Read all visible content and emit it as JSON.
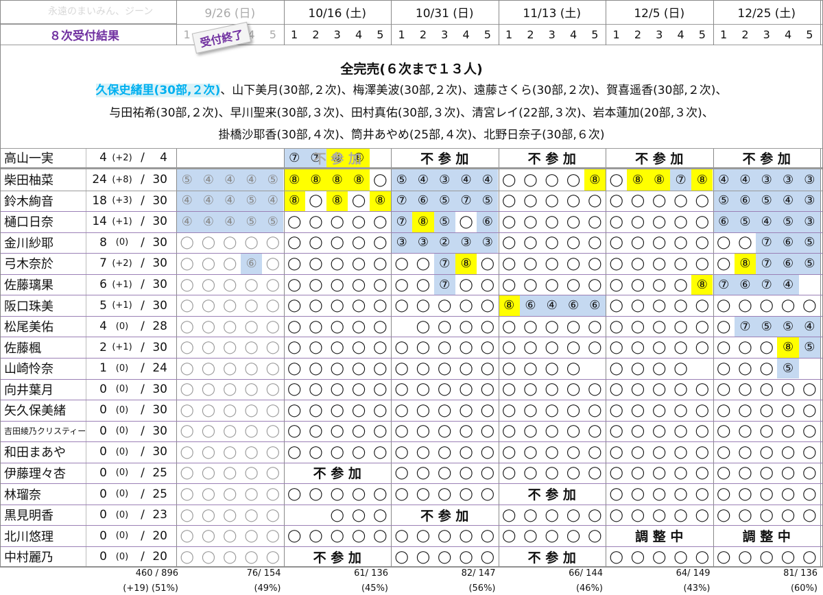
{
  "header": {
    "corner_watermark": "永遠のまいみん、ジーン",
    "round_label": "８次受付結果",
    "stamp": "受付終了",
    "dates": [
      "9/26 (日)",
      "10/16 (土)",
      "10/31 (日)",
      "11/13 (土)",
      "12/5 (日)",
      "12/25 (土)"
    ],
    "slots": [
      "1",
      "2",
      "3",
      "4",
      "5"
    ]
  },
  "banner": {
    "title": "全完売(６次まで１３人)",
    "line1_highlight": "久保史緒里(30部,２次)",
    "line1_rest": "、山下美月(30部,２次)、梅澤美波(30部,２次)、遠藤さくら(30部,２次)、賀喜遥香(30部,２次)、",
    "line2": "与田祐希(30部,２次)、早川聖来(30部,３次)、田村真佑(30部,３次)、清宮レイ(22部,３次)、岩本蓮加(20部,３次)、",
    "line3": "掛橋沙耶香(30部,４次)、筒井あやめ(25部,４次)、北野日奈子(30部,６次)"
  },
  "colors": {
    "blue": "#c5d9f1",
    "yellow": "#ffff00",
    "purple": "#7030a0",
    "banner_highlight": "#dbf2f7",
    "highlight_text": "#00b0f0"
  },
  "members": [
    {
      "name": "高山一実",
      "sold": "4",
      "delta": "(+2)",
      "total": "4",
      "cells": [
        "",
        "",
        "",
        "",
        "",
        "b⑦",
        "b⑦",
        "y⑧",
        "y⑧",
        "",
        "",
        "",
        "",
        "",
        "",
        "",
        "",
        "",
        "",
        "",
        "",
        "",
        "",
        "",
        "",
        "",
        "",
        "",
        "",
        ""
      ],
      "spans": [
        {
          "col": 1,
          "text": "不 参 加",
          "gray": true
        },
        {
          "col": 2,
          "text": "不 参 加"
        },
        {
          "col": 3,
          "text": "不 参 加"
        },
        {
          "col": 4,
          "text": "不 参 加"
        },
        {
          "col": 5,
          "text": "不 参 加"
        }
      ]
    },
    {
      "name": "柴田柚菜",
      "sold": "24",
      "delta": "(+8)",
      "total": "30",
      "cells": [
        "b⑤",
        "b④",
        "b④",
        "b④",
        "b⑤",
        "y⑧",
        "y⑧",
        "y⑧",
        "y⑧",
        "O",
        "b⑤",
        "b④",
        "b③",
        "b④",
        "b④",
        "O",
        "O",
        "O",
        "O",
        "y⑧",
        "O",
        "y⑧",
        "y⑧",
        "b⑦",
        "y⑧",
        "b④",
        "b④",
        "b③",
        "b③",
        "b③"
      ],
      "spans": []
    },
    {
      "name": "鈴木絢音",
      "sold": "18",
      "delta": "(+3)",
      "total": "30",
      "cells": [
        "b④",
        "b④",
        "b④",
        "b⑤",
        "b④",
        "y⑧",
        "O",
        "y⑧",
        "O",
        "y⑧",
        "b⑦",
        "b⑥",
        "b⑤",
        "b⑦",
        "b⑤",
        "O",
        "O",
        "O",
        "O",
        "O",
        "O",
        "O",
        "O",
        "O",
        "O",
        "b⑤",
        "b⑥",
        "b⑤",
        "b④",
        "b③"
      ],
      "spans": []
    },
    {
      "name": "樋口日奈",
      "sold": "14",
      "delta": "(+1)",
      "total": "30",
      "cells": [
        "b④",
        "b④",
        "b④",
        "b⑤",
        "b⑤",
        "O",
        "O",
        "O",
        "O",
        "O",
        "b⑦",
        "y⑧",
        "b⑤",
        "O",
        "b⑥",
        "O",
        "O",
        "O",
        "O",
        "O",
        "O",
        "O",
        "O",
        "O",
        "O",
        "b⑥",
        "b⑤",
        "b④",
        "b⑤",
        "b③"
      ],
      "spans": []
    },
    {
      "name": "金川紗耶",
      "sold": "8",
      "delta": "(0)",
      "total": "30",
      "cells": [
        "O",
        "O",
        "O",
        "O",
        "O",
        "O",
        "O",
        "O",
        "O",
        "O",
        "b③",
        "b③",
        "b②",
        "b③",
        "b③",
        "O",
        "O",
        "O",
        "O",
        "O",
        "O",
        "O",
        "O",
        "O",
        "O",
        "O",
        "O",
        "b⑦",
        "b⑥",
        "b⑤"
      ],
      "spans": []
    },
    {
      "name": "弓木奈於",
      "sold": "7",
      "delta": "(+2)",
      "total": "30",
      "cells": [
        "O",
        "O",
        "O",
        "b⑥",
        "O",
        "O",
        "O",
        "O",
        "O",
        "O",
        "O",
        "O",
        "b⑦",
        "y⑧",
        "O",
        "O",
        "O",
        "O",
        "O",
        "O",
        "O",
        "O",
        "O",
        "O",
        "O",
        "O",
        "y⑧",
        "b⑦",
        "b⑥",
        "b⑤"
      ],
      "spans": []
    },
    {
      "name": "佐藤璃果",
      "sold": "6",
      "delta": "(+1)",
      "total": "30",
      "cells": [
        "O",
        "O",
        "O",
        "O",
        "O",
        "O",
        "O",
        "O",
        "O",
        "O",
        "O",
        "O",
        "b⑦",
        "O",
        "O",
        "O",
        "O",
        "O",
        "O",
        "O",
        "O",
        "O",
        "O",
        "O",
        "y⑧",
        "b⑦",
        "b⑥",
        "b⑦",
        "b④",
        ""
      ],
      "spans": []
    },
    {
      "name": "阪口珠美",
      "sold": "5",
      "delta": "(+1)",
      "total": "30",
      "cells": [
        "O",
        "O",
        "O",
        "O",
        "O",
        "O",
        "O",
        "O",
        "O",
        "O",
        "O",
        "O",
        "O",
        "O",
        "O",
        "y⑧",
        "b⑥",
        "b④",
        "b⑥",
        "b⑥",
        "O",
        "O",
        "O",
        "O",
        "O",
        "O",
        "O",
        "O",
        "O",
        "O"
      ],
      "spans": []
    },
    {
      "name": "松尾美佑",
      "sold": "4",
      "delta": "(0)",
      "total": "28",
      "cells": [
        "O",
        "O",
        "O",
        "O",
        "O",
        "O",
        "O",
        "O",
        "O",
        "O",
        "",
        "O",
        "O",
        "O",
        "O",
        "O",
        "O",
        "O",
        "O",
        "O",
        "O",
        "O",
        "O",
        "O",
        "O",
        "O",
        "b⑦",
        "b⑤",
        "b⑤",
        "b④"
      ],
      "spans": []
    },
    {
      "name": "佐藤楓",
      "sold": "2",
      "delta": "(+1)",
      "total": "30",
      "cells": [
        "O",
        "O",
        "O",
        "O",
        "O",
        "O",
        "O",
        "O",
        "O",
        "O",
        "O",
        "O",
        "O",
        "O",
        "O",
        "O",
        "O",
        "O",
        "O",
        "O",
        "O",
        "O",
        "O",
        "O",
        "O",
        "O",
        "O",
        "O",
        "y⑧",
        "b⑤"
      ],
      "spans": []
    },
    {
      "name": "山崎怜奈",
      "sold": "1",
      "delta": "(0)",
      "total": "24",
      "cells": [
        "O",
        "O",
        "O",
        "O",
        "O",
        "O",
        "O",
        "O",
        "O",
        "O",
        "O",
        "O",
        "O",
        "O",
        "O",
        "O",
        "O",
        "O",
        "O",
        "",
        "O",
        "O",
        "O",
        "O",
        "",
        "O",
        "O",
        "O",
        "b⑤",
        ""
      ],
      "spans": []
    },
    {
      "name": "向井葉月",
      "sold": "0",
      "delta": "(0)",
      "total": "30",
      "cells": [
        "O",
        "O",
        "O",
        "O",
        "O",
        "O",
        "O",
        "O",
        "O",
        "O",
        "O",
        "O",
        "O",
        "O",
        "O",
        "O",
        "O",
        "O",
        "O",
        "O",
        "O",
        "O",
        "O",
        "O",
        "O",
        "O",
        "O",
        "O",
        "O",
        "O"
      ],
      "spans": []
    },
    {
      "name": "矢久保美緒",
      "sold": "0",
      "delta": "(0)",
      "total": "30",
      "cells": [
        "O",
        "O",
        "O",
        "O",
        "O",
        "O",
        "O",
        "O",
        "O",
        "O",
        "O",
        "O",
        "O",
        "O",
        "O",
        "O",
        "O",
        "O",
        "O",
        "O",
        "O",
        "O",
        "O",
        "O",
        "O",
        "O",
        "O",
        "O",
        "O",
        "O"
      ],
      "spans": []
    },
    {
      "name": "吉田綾乃クリスティー",
      "sold": "0",
      "delta": "(0)",
      "total": "30",
      "small": true,
      "cells": [
        "O",
        "O",
        "O",
        "O",
        "O",
        "O",
        "O",
        "O",
        "O",
        "O",
        "O",
        "O",
        "O",
        "O",
        "O",
        "O",
        "O",
        "O",
        "O",
        "O",
        "O",
        "O",
        "O",
        "O",
        "O",
        "O",
        "O",
        "O",
        "O",
        "O"
      ],
      "spans": []
    },
    {
      "name": "和田まあや",
      "sold": "0",
      "delta": "(0)",
      "total": "30",
      "cells": [
        "O",
        "O",
        "O",
        "O",
        "O",
        "O",
        "O",
        "O",
        "O",
        "O",
        "O",
        "O",
        "O",
        "O",
        "O",
        "O",
        "O",
        "O",
        "O",
        "O",
        "O",
        "O",
        "O",
        "O",
        "O",
        "O",
        "O",
        "O",
        "O",
        "O"
      ],
      "spans": []
    },
    {
      "name": "伊藤理々杏",
      "sold": "0",
      "delta": "(0)",
      "total": "25",
      "cells": [
        "O",
        "O",
        "O",
        "O",
        "O",
        "",
        "",
        "",
        "",
        "",
        "O",
        "O",
        "O",
        "O",
        "O",
        "O",
        "O",
        "O",
        "O",
        "O",
        "O",
        "O",
        "O",
        "O",
        "O",
        "O",
        "O",
        "O",
        "O",
        "O"
      ],
      "spans": [
        {
          "col": 1,
          "text": "不 参 加"
        }
      ]
    },
    {
      "name": "林瑠奈",
      "sold": "0",
      "delta": "(0)",
      "total": "25",
      "cells": [
        "O",
        "O",
        "O",
        "O",
        "O",
        "O",
        "O",
        "O",
        "O",
        "O",
        "O",
        "O",
        "O",
        "O",
        "O",
        "",
        "",
        "",
        "",
        "",
        "O",
        "O",
        "O",
        "O",
        "O",
        "O",
        "O",
        "O",
        "O",
        "O"
      ],
      "spans": [
        {
          "col": 3,
          "text": "不 参 加"
        }
      ]
    },
    {
      "name": "黒見明香",
      "sold": "0",
      "delta": "(0)",
      "total": "23",
      "cells": [
        "O",
        "O",
        "O",
        "O",
        "O",
        "",
        "",
        "O",
        "O",
        "O",
        "",
        "",
        "",
        "",
        "",
        "O",
        "O",
        "O",
        "O",
        "O",
        "O",
        "O",
        "O",
        "O",
        "O",
        "O",
        "O",
        "O",
        "O",
        "O"
      ],
      "spans": [
        {
          "col": 2,
          "text": "不 参 加"
        }
      ]
    },
    {
      "name": "北川悠理",
      "sold": "0",
      "delta": "(0)",
      "total": "20",
      "cells": [
        "O",
        "O",
        "O",
        "O",
        "O",
        "O",
        "O",
        "O",
        "O",
        "O",
        "O",
        "O",
        "O",
        "O",
        "O",
        "O",
        "O",
        "O",
        "O",
        "O",
        "",
        "",
        "",
        "",
        "",
        "",
        "",
        "",
        "",
        ""
      ],
      "spans": [
        {
          "col": 4,
          "text": "調 整 中"
        },
        {
          "col": 5,
          "text": "調 整 中"
        }
      ]
    },
    {
      "name": "中村麗乃",
      "sold": "0",
      "delta": "(0)",
      "total": "20",
      "cells": [
        "O",
        "O",
        "O",
        "O",
        "O",
        "",
        "",
        "",
        "",
        "",
        "O",
        "O",
        "O",
        "O",
        "O",
        "",
        "",
        "",
        "",
        "",
        "O",
        "O",
        "O",
        "O",
        "O",
        "O",
        "O",
        "O",
        "O",
        "O"
      ],
      "spans": [
        {
          "col": 1,
          "text": "不 参 加"
        },
        {
          "col": 3,
          "text": "不 参 加"
        }
      ]
    }
  ],
  "footer": {
    "total": "460 / 896",
    "total_sub": "(+19) (51%)",
    "dates": [
      {
        "count": "76/ 154",
        "pct": "(49%)"
      },
      {
        "count": "61/ 136",
        "pct": "(45%)"
      },
      {
        "count": "82/ 147",
        "pct": "(56%)"
      },
      {
        "count": "66/ 144",
        "pct": "(46%)"
      },
      {
        "count": "64/ 149",
        "pct": "(43%)"
      },
      {
        "count": "81/ 136",
        "pct": "(60%)"
      }
    ]
  }
}
